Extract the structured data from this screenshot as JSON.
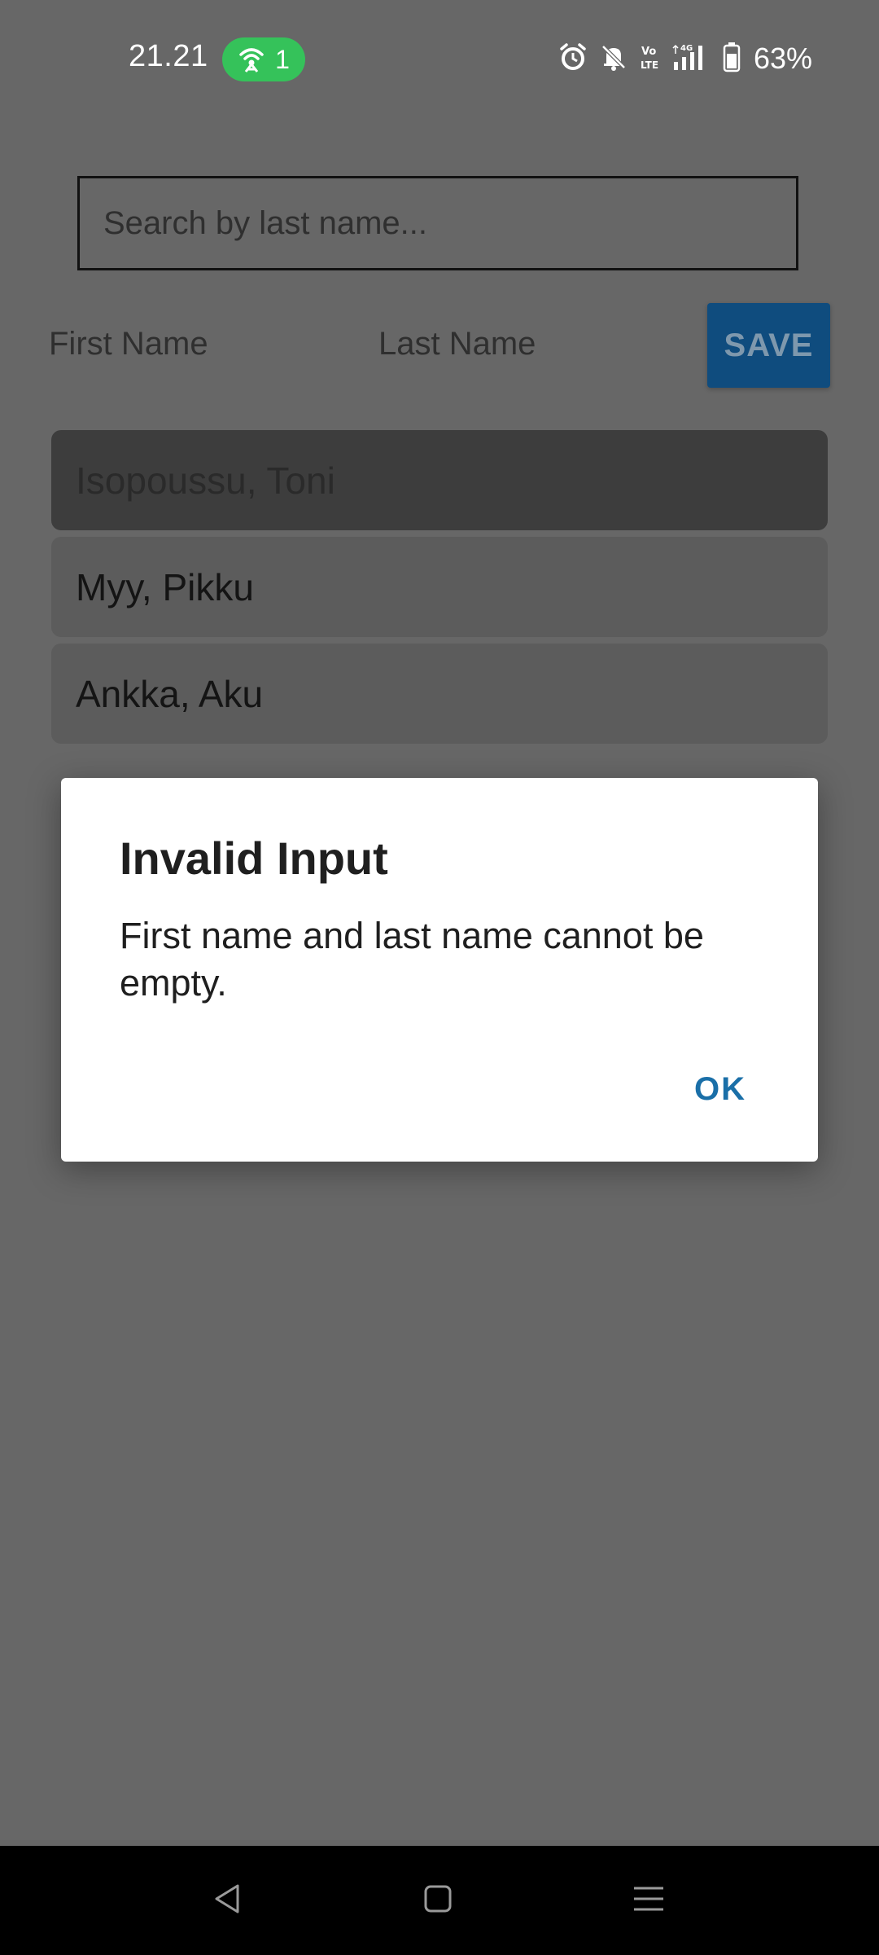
{
  "status_bar": {
    "time": "21.21",
    "hotspot_count": "1",
    "battery_percent": "63%",
    "icons": [
      "hotspot-icon",
      "alarm-icon",
      "bell-muted-icon",
      "volte-icon",
      "signal-4g-icon",
      "battery-icon"
    ],
    "colors": {
      "hotspot_pill": "#35c25a"
    }
  },
  "search": {
    "placeholder": "Search by last name..."
  },
  "form": {
    "first_name_placeholder": "First Name",
    "last_name_placeholder": "Last Name",
    "save_label": "SAVE",
    "save_color": "#0f4c7e"
  },
  "people": [
    {
      "label": "Isopoussu, Toni",
      "selected": true
    },
    {
      "label": "Myy, Pikku",
      "selected": false
    },
    {
      "label": "Ankka, Aku",
      "selected": false
    }
  ],
  "dialog": {
    "title": "Invalid Input",
    "message": "First name and last name cannot be empty.",
    "ok_label": "OK",
    "accent_color": "#1a6fa8"
  },
  "nav_bar": {
    "icons": [
      "back-icon",
      "home-icon",
      "recents-icon"
    ]
  }
}
